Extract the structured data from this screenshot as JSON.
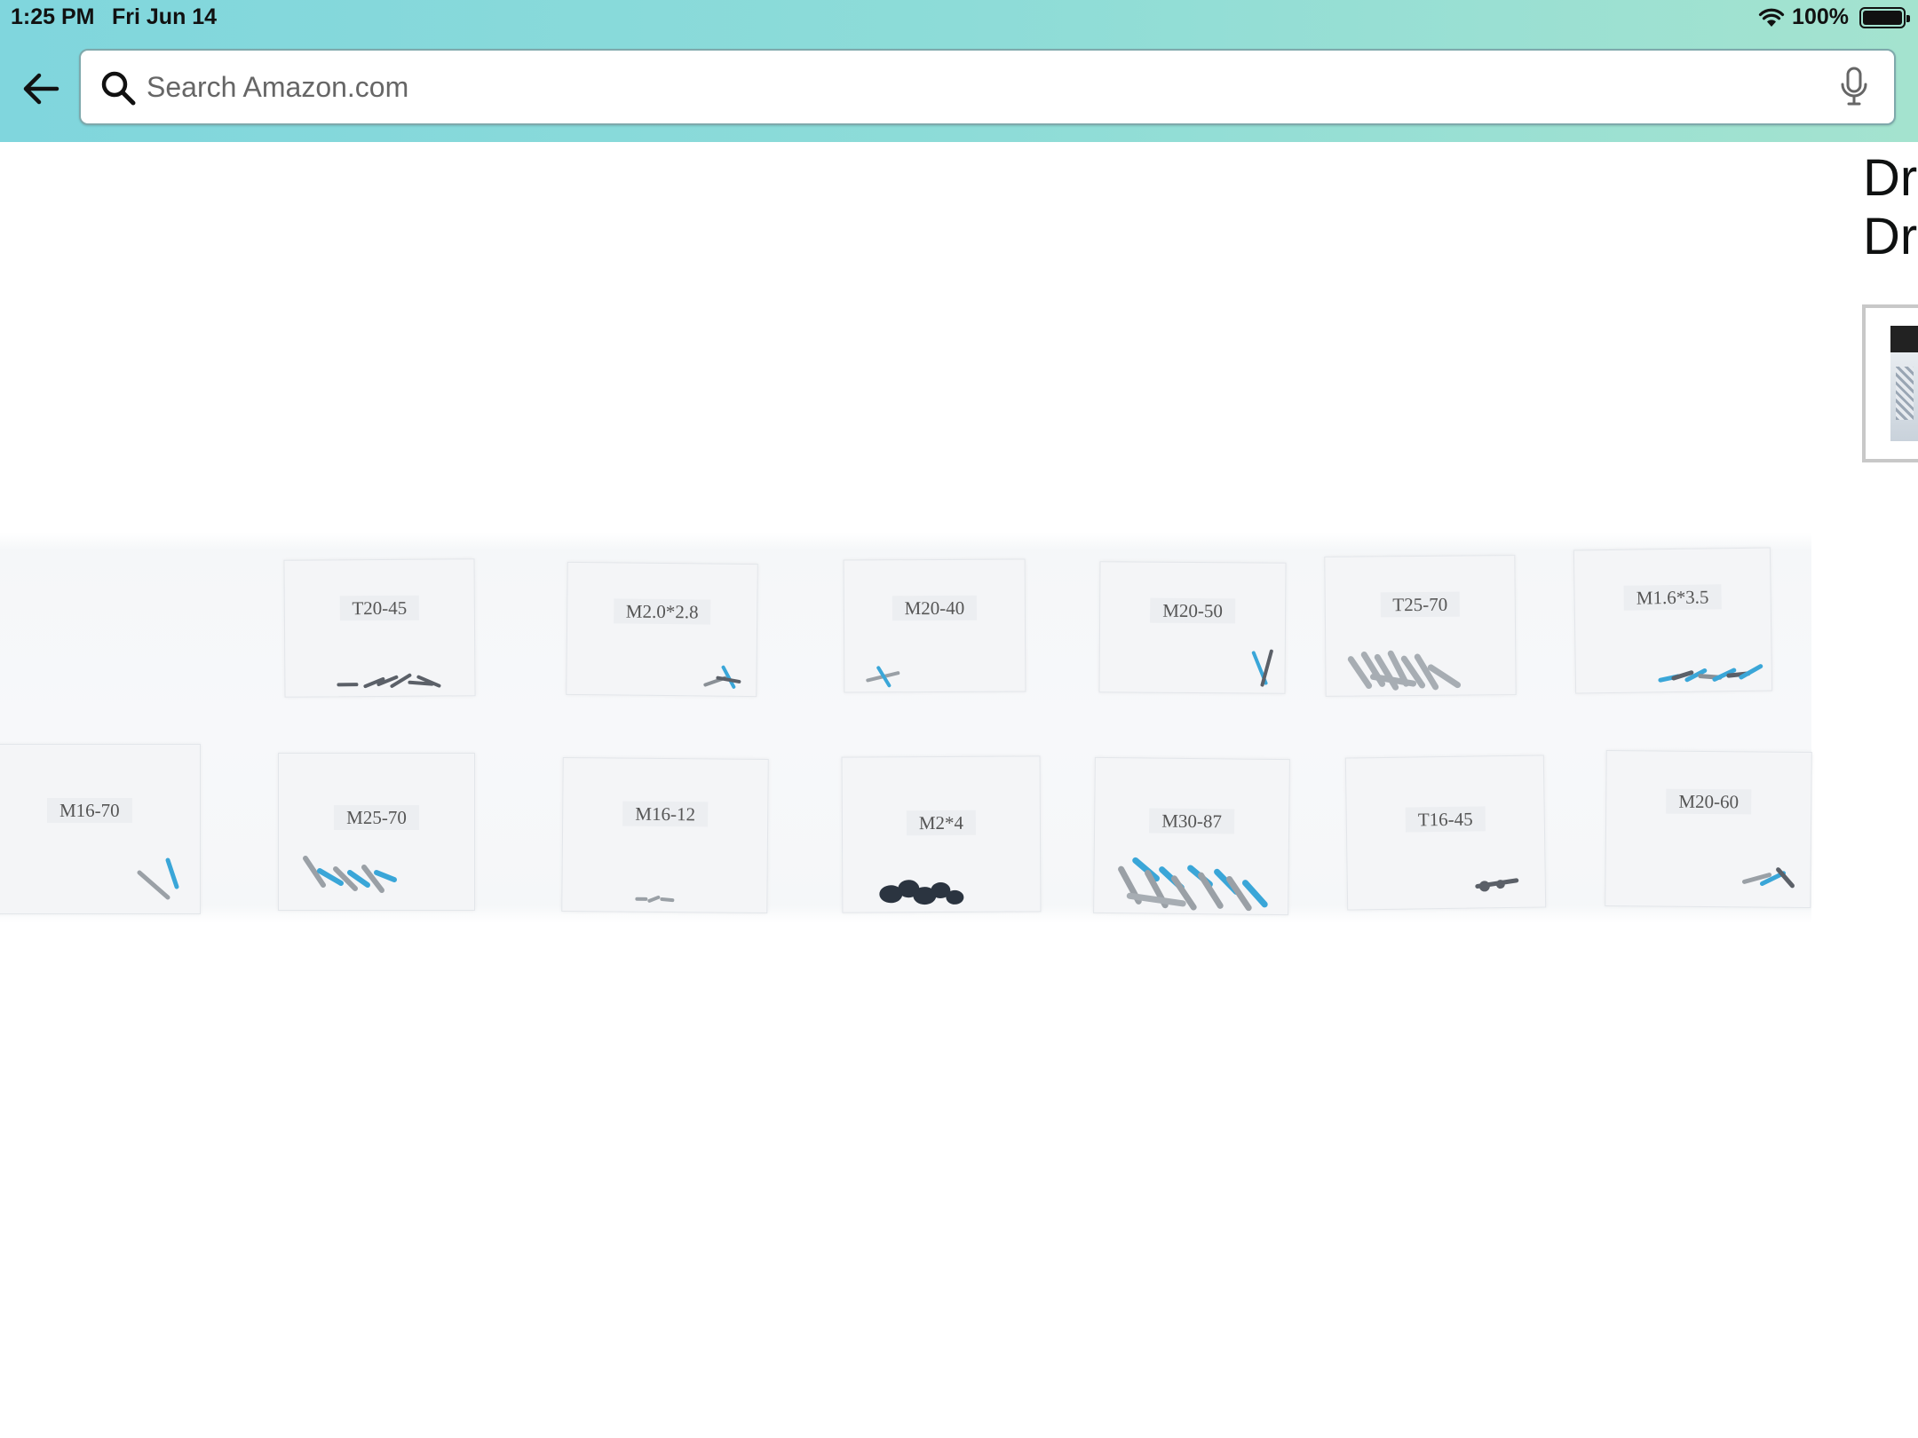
{
  "status_bar": {
    "time": "1:25 PM",
    "date": "Fri Jun 14",
    "battery_percent": "100%",
    "battery_level": 1.0,
    "icons": [
      "wifi-icon",
      "battery-icon"
    ]
  },
  "header": {
    "back_icon": "arrow-left-icon",
    "search": {
      "placeholder": "Search Amazon.com",
      "value": "",
      "search_icon": "magnifier-icon",
      "mic_icon": "microphone-icon"
    }
  },
  "product": {
    "title_lines": [
      "Dr",
      "Dr"
    ],
    "image": {
      "top_row_labels": [
        "T20-45",
        "M2.0*2.8",
        "M20-40",
        "M20-50",
        "T25-70",
        "M1.6*3.5"
      ],
      "bottom_row_labels": [
        "M16-70",
        "M25-70",
        "M16-12",
        "M2*4",
        "M30-87",
        "T16-45",
        "M20-60"
      ]
    }
  },
  "colors": {
    "header_gradient_start": "#80d6dd",
    "header_gradient_end": "#a4e3cf",
    "screw_blue": "#3aa6d8",
    "screw_metal": "#9aa0a6",
    "screw_dark": "#2b3440"
  }
}
